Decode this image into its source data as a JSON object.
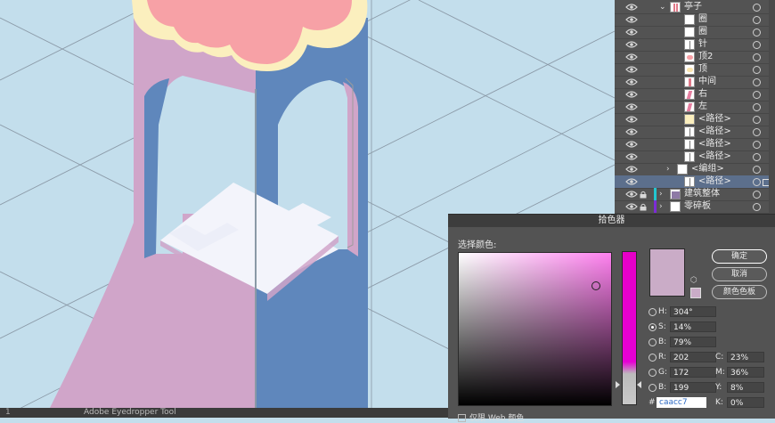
{
  "status": {
    "zoom": "1",
    "tool": "Adobe Eyedropper Tool"
  },
  "layers": [
    {
      "name": "亭子",
      "indent": 0,
      "expanded": true,
      "thumb": "pink-sticks",
      "accent": ""
    },
    {
      "name": "圈",
      "indent": 2,
      "thumb": "white",
      "accent": ""
    },
    {
      "name": "圈",
      "indent": 2,
      "thumb": "white",
      "accent": ""
    },
    {
      "name": "针",
      "indent": 2,
      "thumb": "stick",
      "accent": ""
    },
    {
      "name": "顶2",
      "indent": 2,
      "thumb": "pinkblob",
      "accent": ""
    },
    {
      "name": "顶",
      "indent": 2,
      "thumb": "creamblob",
      "accent": ""
    },
    {
      "name": "中间",
      "indent": 2,
      "thumb": "pinkbar",
      "accent": ""
    },
    {
      "name": "右",
      "indent": 2,
      "thumb": "pinkstripe",
      "accent": ""
    },
    {
      "name": "左",
      "indent": 2,
      "thumb": "pinkstripe",
      "accent": ""
    },
    {
      "name": "<路径>",
      "indent": 2,
      "thumb": "cream",
      "accent": ""
    },
    {
      "name": "<路径>",
      "indent": 2,
      "thumb": "stick",
      "accent": ""
    },
    {
      "name": "<路径>",
      "indent": 2,
      "thumb": "stick",
      "accent": ""
    },
    {
      "name": "<路径>",
      "indent": 2,
      "thumb": "stick",
      "accent": ""
    },
    {
      "name": "<编组>",
      "indent": 1,
      "collapsed": true,
      "thumb": "white",
      "accent": ""
    },
    {
      "name": "<路径>",
      "indent": 2,
      "thumb": "stick",
      "accent": "",
      "selected": true
    },
    {
      "name": "建筑整体",
      "indent": 0,
      "collapsed": true,
      "locked": true,
      "thumb": "building",
      "accent": "#22c6d0"
    },
    {
      "name": "零碎板",
      "indent": 0,
      "collapsed": true,
      "locked": true,
      "thumb": "white",
      "accent": "#7d2bd6"
    }
  ],
  "picker": {
    "title": "拾色器",
    "select_label": "选择颜色:",
    "buttons": {
      "ok": "确定",
      "cancel": "取消",
      "swatches": "颜色色板"
    },
    "hsb": [
      {
        "key": "H:",
        "value": "304°",
        "on": false
      },
      {
        "key": "S:",
        "value": "14%",
        "on": true
      },
      {
        "key": "B:",
        "value": "79%",
        "on": false
      }
    ],
    "rgb": [
      {
        "key": "R:",
        "value": "202"
      },
      {
        "key": "G:",
        "value": "172"
      },
      {
        "key": "B:",
        "value": "199"
      }
    ],
    "cmyk": [
      {
        "key": "C:",
        "value": "23%"
      },
      {
        "key": "M:",
        "value": "36%"
      },
      {
        "key": "Y:",
        "value": "8%"
      },
      {
        "key": "K:",
        "value": "0%"
      }
    ],
    "hex_label": "#",
    "hex": "caacc7",
    "web_only": "仅限 Web 颜色",
    "current_color": "#caacc7"
  },
  "colors": {
    "canvas_bg": "#c3deec",
    "tower_pink": "#d0a5c9",
    "tower_blue": "#5f87bc",
    "roof_pink": "#f7a1a6",
    "roof_cream": "#fbefbe",
    "steps_white": "#f3f4fb"
  }
}
